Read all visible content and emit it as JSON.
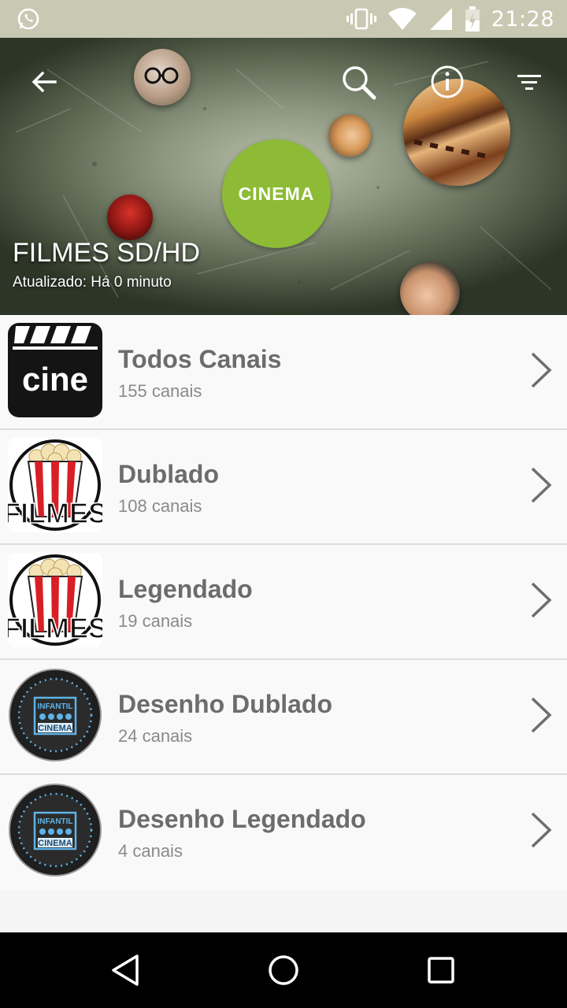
{
  "status_bar": {
    "time": "21:28",
    "icons": [
      "whatsapp-icon",
      "vibrate-icon",
      "wifi-icon",
      "signal-icon",
      "battery-icon"
    ]
  },
  "header": {
    "title": "FILMES SD/HD",
    "subtitle": "Atualizado: Há 0 minuto",
    "banner_text": "CINEMA",
    "actions": [
      "back-arrow-icon",
      "search-icon",
      "info-icon",
      "filter-icon"
    ]
  },
  "list": {
    "items": [
      {
        "title": "Todos Canais",
        "count": "155 canais",
        "thumb": "cine-clapperboard",
        "thumb_text": "cine"
      },
      {
        "title": "Dublado",
        "count": "108 canais",
        "thumb": "popcorn-filmes",
        "thumb_text": "FILMES"
      },
      {
        "title": "Legendado",
        "count": "19 canais",
        "thumb": "popcorn-filmes",
        "thumb_text": "FILMES"
      },
      {
        "title": "Desenho Dublado",
        "count": "24 canais",
        "thumb": "infantil-cinema",
        "thumb_text": "INFANTIL",
        "thumb_text2": "CINEMA"
      },
      {
        "title": "Desenho Legendado",
        "count": "4 canais",
        "thumb": "infantil-cinema",
        "thumb_text": "INFANTIL",
        "thumb_text2": "CINEMA"
      }
    ]
  },
  "nav_bar": {
    "buttons": [
      "back-triangle-icon",
      "home-circle-icon",
      "recents-square-icon"
    ]
  },
  "colors": {
    "status_bar": "#c9c9b3",
    "banner_green": "#8dbb35",
    "list_bg": "#f9f9f9",
    "title_text": "#6c6c6c",
    "sub_text": "#8a8a8a"
  }
}
